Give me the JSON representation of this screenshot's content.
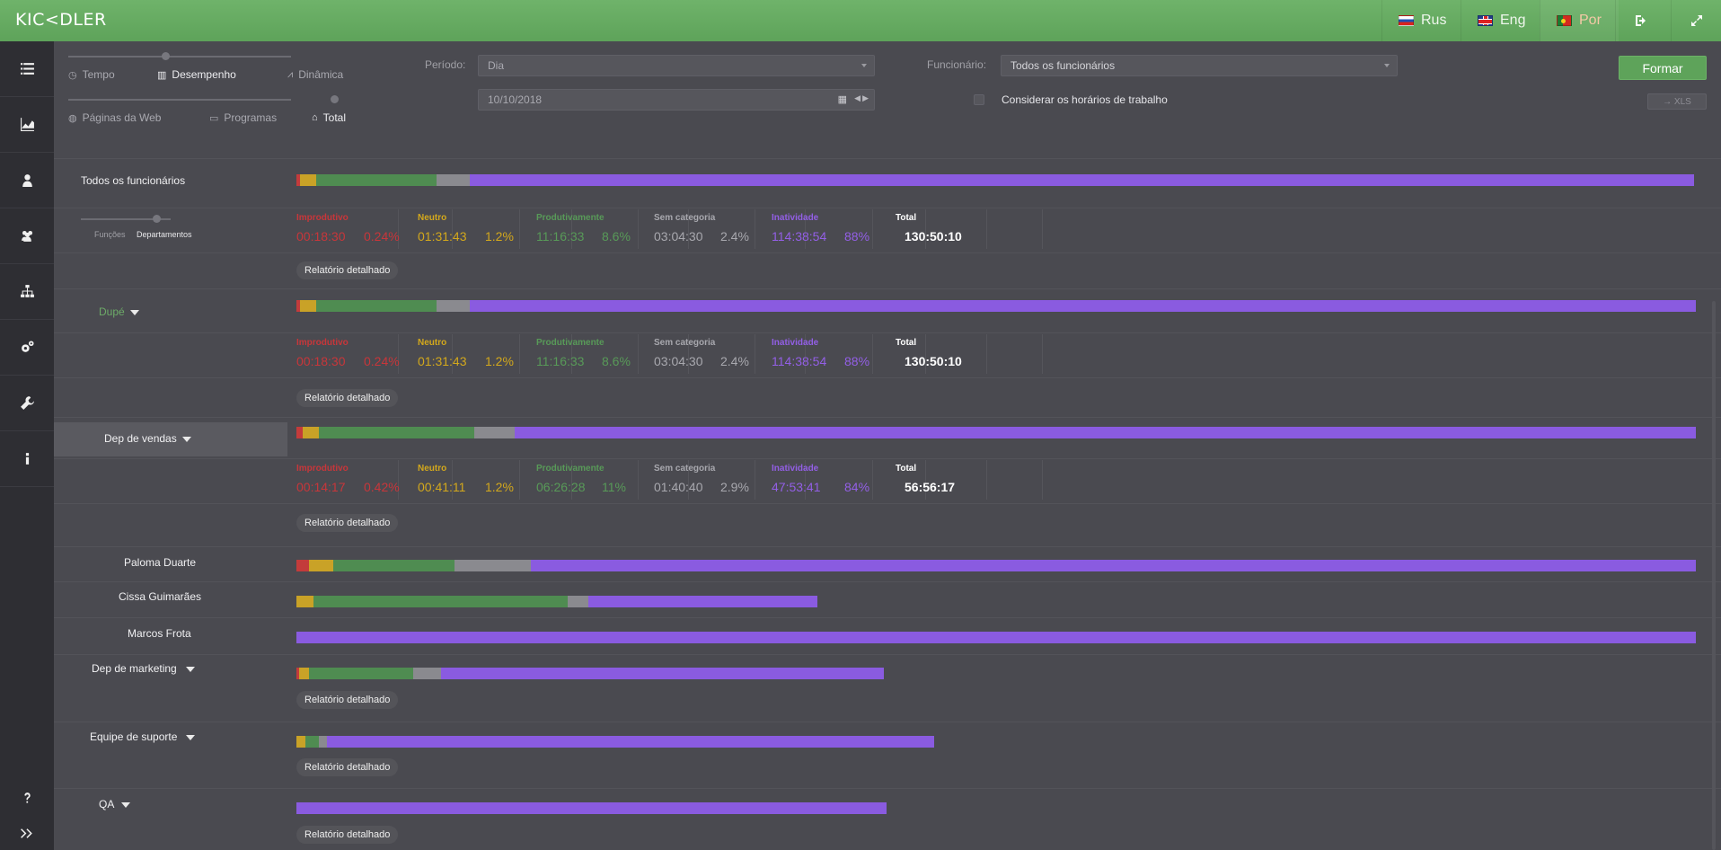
{
  "app": {
    "logo": "KIC<DLER"
  },
  "header": {
    "languages": [
      {
        "label": "Rus",
        "flag": "ru",
        "active": false
      },
      {
        "label": "Eng",
        "flag": "en",
        "active": false
      },
      {
        "label": "Por",
        "flag": "pt",
        "active": true
      }
    ],
    "icons": [
      "logout-icon",
      "fullscreen-icon"
    ]
  },
  "sidebar": {
    "items": [
      "list-icon",
      "chart-icon",
      "user-icon",
      "users-icon",
      "hierarchy-icon",
      "settings-icon",
      "wrench-icon",
      "info-icon"
    ],
    "bottom": [
      "help-icon",
      "expand-icon"
    ]
  },
  "filters": {
    "tabs_row1": [
      {
        "label": "Tempo",
        "icon": "clock-icon",
        "active": false
      },
      {
        "label": "Desempenho",
        "icon": "bar-chart-icon",
        "active": true
      },
      {
        "label": "Dinâmica",
        "icon": "line-chart-icon",
        "active": false
      }
    ],
    "tabs_row2": [
      {
        "label": "Páginas da Web",
        "icon": "globe-icon",
        "active": false
      },
      {
        "label": "Programas",
        "icon": "window-icon",
        "active": false
      },
      {
        "label": "Total",
        "icon": "inbox-icon",
        "active": true
      }
    ],
    "periodo_label": "Período:",
    "periodo_value": "Dia",
    "date_value": "10/10/2018",
    "funcionario_label": "Funcionário:",
    "funcionario_value": "Todos os funcionários",
    "work_hours_label": "Considerar os horários de trabalho",
    "formar_label": "Formar",
    "xls_label": "→ XLS"
  },
  "grouping": {
    "options": [
      "Funções",
      "Departamentos"
    ],
    "active": "Departamentos"
  },
  "report_button_label": "Relatório detalhado",
  "stat_labels": {
    "improductive": "Improdutivo",
    "neutral": "Neutro",
    "productive": "Produtivamente",
    "uncategorized": "Sem categoria",
    "inactivity": "Inatividade",
    "total": "Total"
  },
  "rows": [
    {
      "name": "Todos os funcionários",
      "bar": [
        0.24,
        1.2,
        8.6,
        2.4,
        88
      ],
      "stats": {
        "improductive": [
          "00:18:30",
          "0.24%"
        ],
        "neutral": [
          "01:31:43",
          "1.2%"
        ],
        "productive": [
          "11:16:33",
          "8.6%"
        ],
        "uncategorized": [
          "03:04:30",
          "2.4%"
        ],
        "inactivity": [
          "114:38:54",
          "88%"
        ],
        "total": "130:50:10"
      }
    },
    {
      "name": "Dupé",
      "bar": [
        0.24,
        1.2,
        8.6,
        2.4,
        88
      ],
      "stats": {
        "improductive": [
          "00:18:30",
          "0.24%"
        ],
        "neutral": [
          "01:31:43",
          "1.2%"
        ],
        "productive": [
          "11:16:33",
          "8.6%"
        ],
        "uncategorized": [
          "03:04:30",
          "2.4%"
        ],
        "inactivity": [
          "114:38:54",
          "88%"
        ],
        "total": "130:50:10"
      }
    },
    {
      "name": "Dep de vendas",
      "bar": [
        0.42,
        1.2,
        11,
        2.9,
        84
      ],
      "stats": {
        "improductive": [
          "00:14:17",
          "0.42%"
        ],
        "neutral": [
          "00:41:11",
          "1.2%"
        ],
        "productive": [
          "06:26:28",
          "11%"
        ],
        "uncategorized": [
          "01:40:40",
          "2.9%"
        ],
        "inactivity": [
          "47:53:41",
          "84%"
        ],
        "total": "56:56:17"
      }
    }
  ],
  "employees": [
    {
      "name": "Paloma Duarte"
    },
    {
      "name": "Cissa Guimarães"
    },
    {
      "name": "Marcos Frota"
    }
  ],
  "departments": [
    {
      "name": "Dep de marketing"
    },
    {
      "name": "Equipe de suporte"
    },
    {
      "name": "QA"
    }
  ],
  "colors": {
    "improductive": "#c33b3b",
    "neutral": "#c9a227",
    "productive": "#4f8c51",
    "uncategorized": "#8a8a8f",
    "inactivity": "#8a5be0",
    "brand": "#5ea35a"
  }
}
